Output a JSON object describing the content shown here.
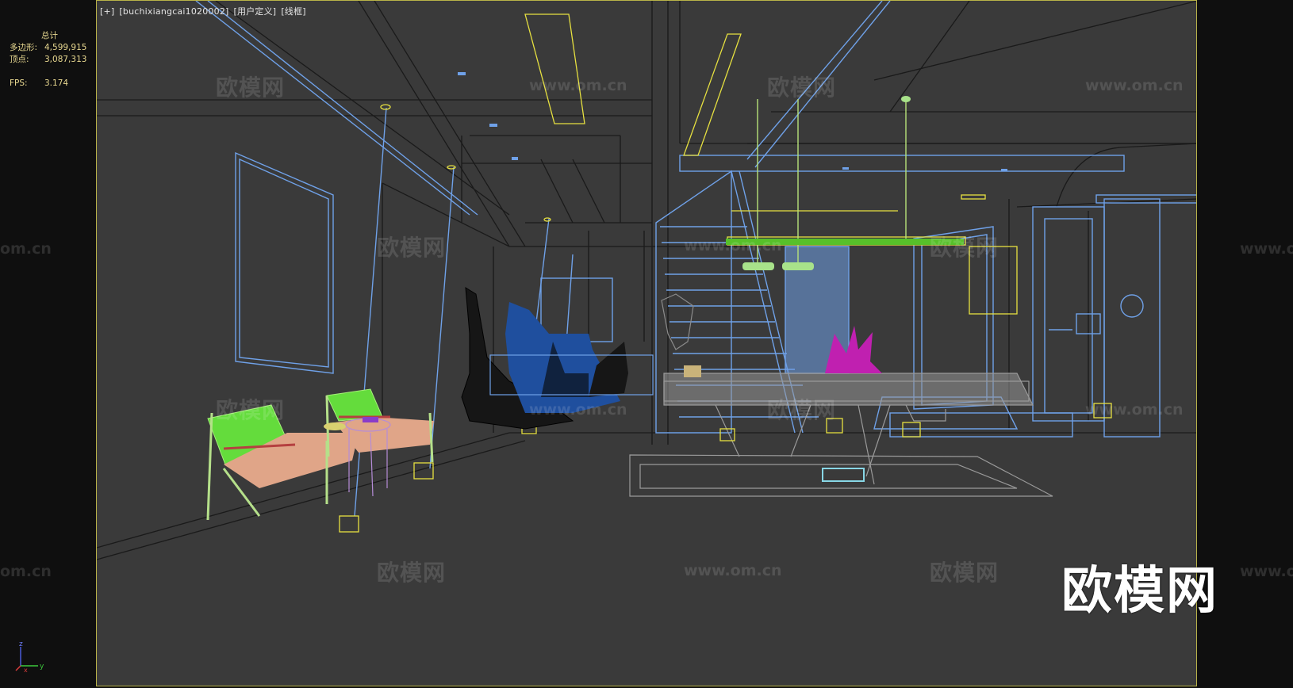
{
  "viewport": {
    "labels": [
      "[+]",
      "[buchixiangcai1020002]",
      "[用户定义]",
      "[线框]"
    ]
  },
  "stats": {
    "total_label": "总计",
    "polygons_label": "多边形:",
    "polygons_value": "4,599,915",
    "vertices_label": "顶点:",
    "vertices_value": "3,087,313",
    "fps_label": "FPS:",
    "fps_value": "3.174"
  },
  "watermarks": {
    "cn": "欧模网",
    "url": "www.om.cn",
    "partial_url": "om.cn",
    "partial_url2": "www.o",
    "big": "欧模网"
  },
  "axis": {
    "z": "z",
    "x": "x",
    "y": "y"
  },
  "colors": {
    "viewport_bg": "#3a3a3a",
    "frame": "#b9b348",
    "wire_blue": "#6fa1e8",
    "wire_dark": "#1a1a1a",
    "wire_yellow": "#e6e040",
    "chair_green": "#64dc3c",
    "chair_seat": "#e0a588",
    "plant_magenta": "#c020b0",
    "gym_blue": "#1f4f9e"
  }
}
